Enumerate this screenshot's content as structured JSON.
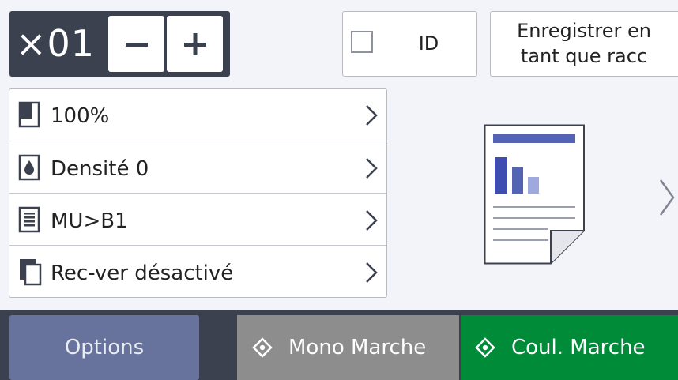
{
  "copy_count": {
    "value": "×01",
    "minus_label": "−",
    "plus_label": "+"
  },
  "id_button": {
    "label": "ID",
    "checked": false
  },
  "shortcut_button": {
    "line1": "Enregistrer en",
    "line2": "tant que racc"
  },
  "settings": [
    {
      "icon": "page-size-icon",
      "label": "100%"
    },
    {
      "icon": "density-drop-icon",
      "label": "Densité 0"
    },
    {
      "icon": "stack-layout-icon",
      "label": "MU>B1"
    },
    {
      "icon": "duplex-pages-icon",
      "label": "Rec-ver désactivé"
    }
  ],
  "preview": {
    "icon": "document-preview-icon"
  },
  "bottom_bar": {
    "options_label": "Options",
    "mono_label": "Mono Marche",
    "color_label": "Coul. Marche"
  },
  "colors": {
    "dark": "#3c4150",
    "options": "#67739c",
    "mono": "#8d8d8d",
    "color_start": "#008b39",
    "preview_accent": "#5563b5"
  }
}
